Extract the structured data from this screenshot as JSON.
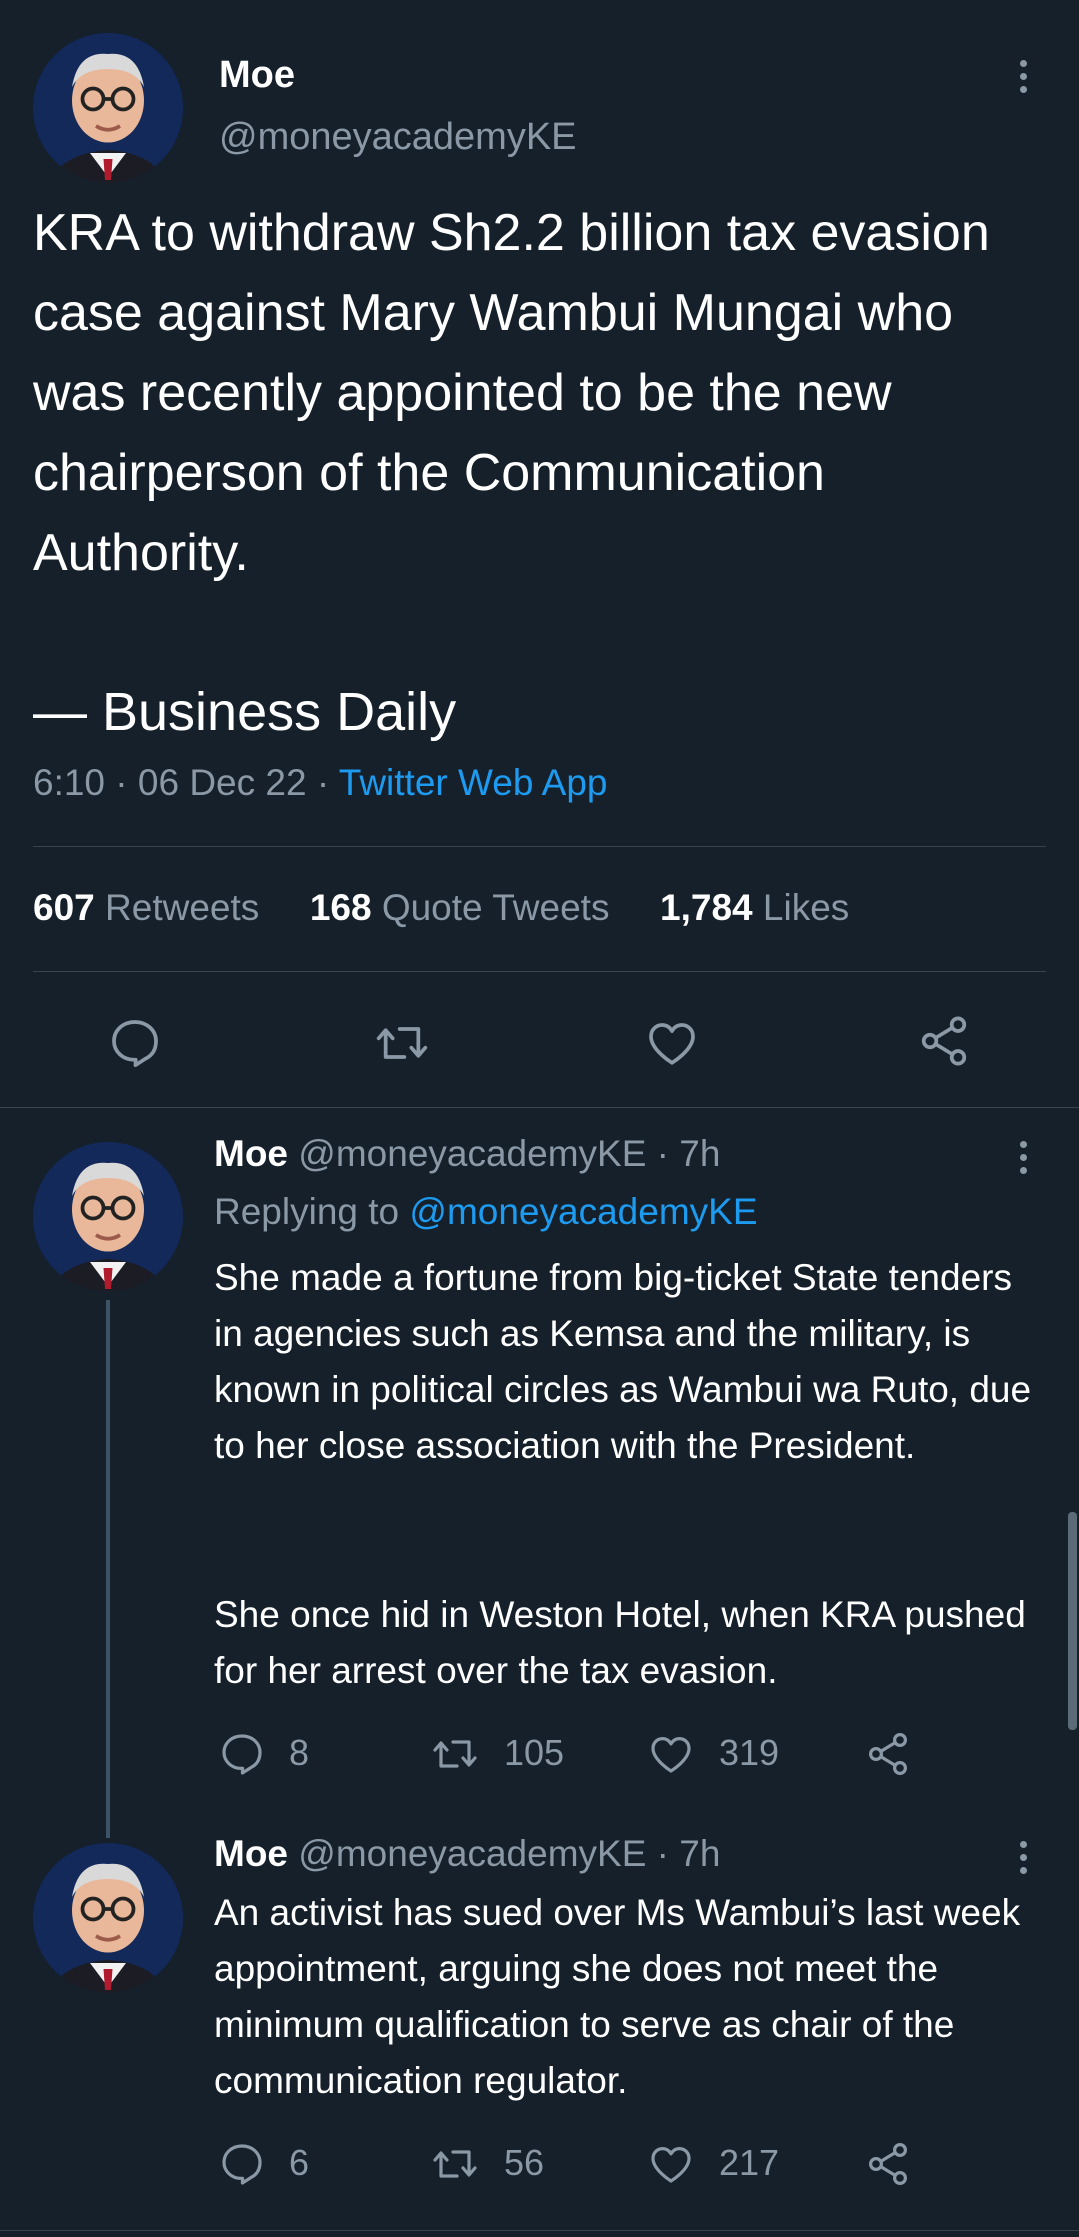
{
  "main_tweet": {
    "display_name": "Moe",
    "handle": "@moneyacademyKE",
    "text": "KRA to withdraw Sh2.2 billion tax evasion case against Mary Wambui Mungai who was recently appointed to be the new chairperson of the Communication Authority.",
    "source_line": "— Business Daily",
    "time": "6:10 · 06 Dec 22 · ",
    "client": "Twitter Web App",
    "stats": {
      "retweets_count": "607",
      "retweets_label": "Retweets",
      "quotes_count": "168",
      "quotes_label": "Quote Tweets",
      "likes_count": "1,784",
      "likes_label": "Likes"
    }
  },
  "replies": [
    {
      "display_name": "Moe",
      "handle_time": "@moneyacademyKE · 7h",
      "replying_prefix": "Replying to ",
      "replying_handle": "@moneyacademyKE",
      "text_p1": "She made a fortune from big-ticket State tenders in agencies such as Kemsa and the military, is known in political circles as Wambui wa Ruto, due to her close association with the President.",
      "text_p2": "She once hid in Weston Hotel, when KRA pushed for her arrest over the tax evasion.",
      "replies_count": "8",
      "retweets_count": "105",
      "likes_count": "319"
    },
    {
      "display_name": "Moe",
      "handle_time": "@moneyacademyKE · 7h",
      "text": "An activist has sued over Ms Wambui’s last week appointment, arguing she does not meet the minimum qualification to serve as chair of the communication regulator.",
      "replies_count": "6",
      "retweets_count": "56",
      "likes_count": "217"
    }
  ],
  "icons": [
    "reply-icon",
    "retweet-icon",
    "like-icon",
    "share-icon",
    "more-icon"
  ],
  "colors": {
    "background": "#15202b",
    "accent": "#1d9bf0",
    "secondary_text": "#8b98a5",
    "divider": "#38444d"
  }
}
